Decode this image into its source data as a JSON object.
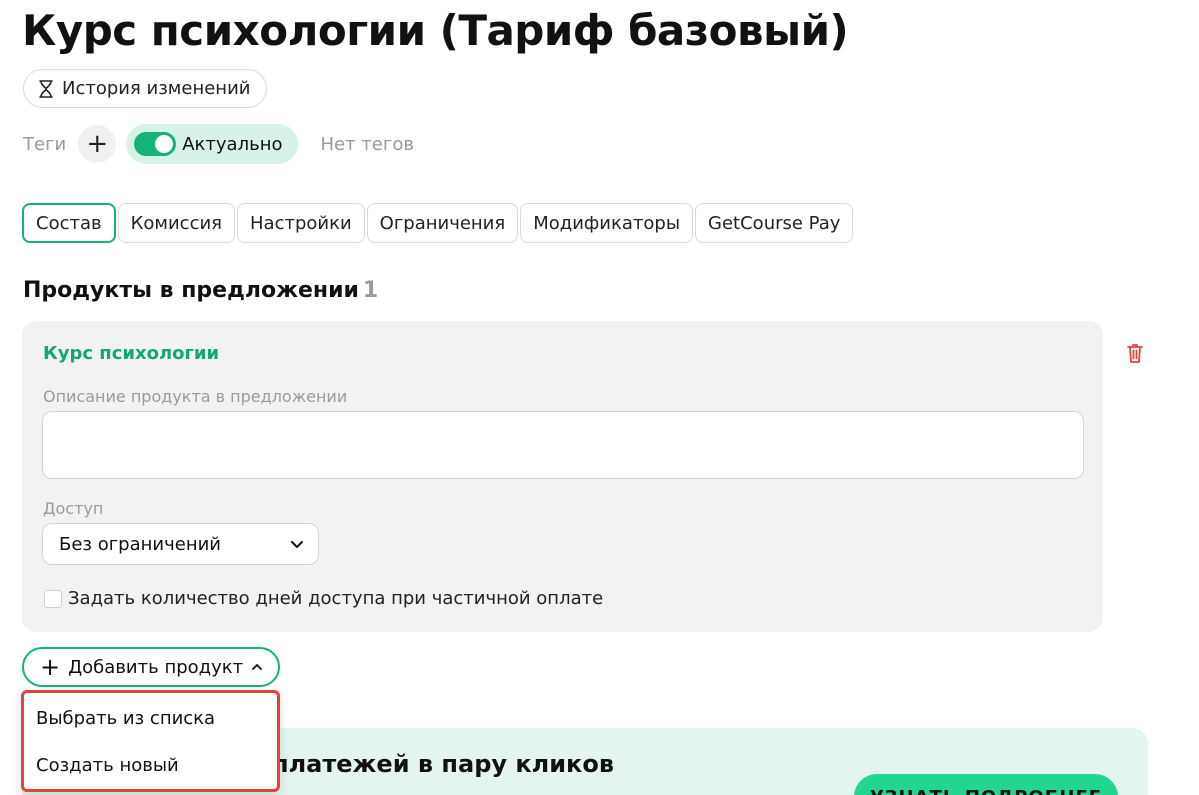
{
  "page": {
    "title": "Курс психологии (Тариф базовый)"
  },
  "history_button": {
    "label": "История изменений",
    "icon": "hourglass-icon"
  },
  "tags": {
    "label": "Теги",
    "add_icon": "+",
    "status_label": "Актуально",
    "status_on": true,
    "empty_text": "Нет тегов"
  },
  "tabs": [
    {
      "label": "Состав",
      "active": true
    },
    {
      "label": "Комиссия",
      "active": false
    },
    {
      "label": "Настройки",
      "active": false
    },
    {
      "label": "Ограничения",
      "active": false
    },
    {
      "label": "Модификаторы",
      "active": false
    },
    {
      "label": "GetCourse Pay",
      "active": false
    }
  ],
  "products_section": {
    "title": "Продукты в предложении",
    "count": "1"
  },
  "product_card": {
    "name": "Курс психологии",
    "description_label": "Описание продукта в предложении",
    "description_value": "",
    "access_label": "Доступ",
    "access_value": "Без ограничений",
    "partial_payment_checkbox_label": "Задать количество дней доступа при частичной оплате",
    "partial_payment_checked": false
  },
  "add_product": {
    "plus": "+",
    "label": "Добавить продукт",
    "menu": [
      "Выбрать из списка",
      "Создать новый"
    ]
  },
  "banner": {
    "text": "платежей в пару кликов",
    "button_label": "УЗНАТЬ ПОДРОБНЕЕ"
  },
  "colors": {
    "accent": "#17b17a",
    "danger": "#e0453d",
    "card_bg": "#f2f2f2",
    "banner_bg": "#e3f5ee"
  }
}
